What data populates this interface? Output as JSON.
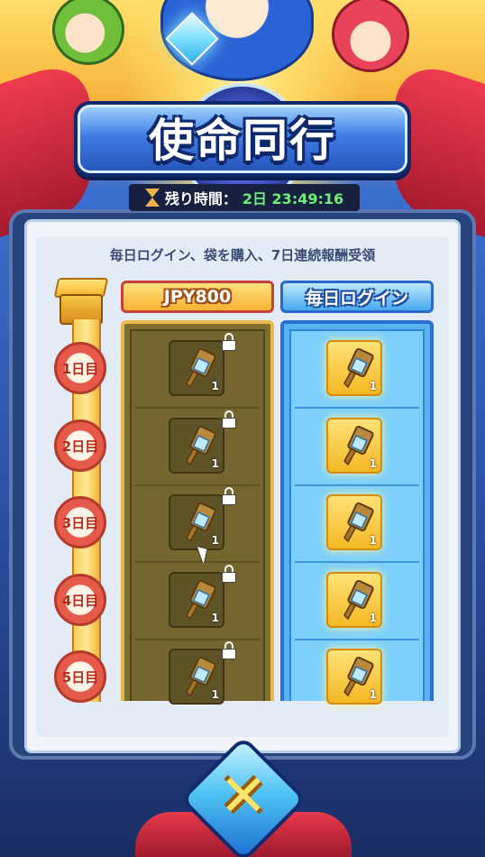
{
  "title": "使命同行",
  "timer": {
    "label": "残り時間：",
    "value": "2日 23:49:16"
  },
  "description": "毎日ログイン、袋を購入、7日連続報酬受領",
  "columns": {
    "paid_label": "JPY800",
    "free_label": "毎日ログイン"
  },
  "days": [
    {
      "label": "1日目",
      "paid_qty": "1",
      "free_qty": "1",
      "paid_locked": true
    },
    {
      "label": "2日目",
      "paid_qty": "1",
      "free_qty": "1",
      "paid_locked": true
    },
    {
      "label": "3日目",
      "paid_qty": "1",
      "free_qty": "1",
      "paid_locked": true
    },
    {
      "label": "4日目",
      "paid_qty": "1",
      "free_qty": "1",
      "paid_locked": true
    },
    {
      "label": "5日目",
      "paid_qty": "1",
      "free_qty": "1",
      "paid_locked": true
    }
  ],
  "icons": {
    "reward": "key-crystal-icon",
    "lock": "lock-icon",
    "timer": "hourglass-icon",
    "chest": "gift-box-icon",
    "emblem": "x-emblem-icon"
  },
  "colors": {
    "timer_value": "#6df07a",
    "paid_column": "#807030",
    "free_column": "#57b4f0",
    "title_outline": "#0f2a6e"
  }
}
